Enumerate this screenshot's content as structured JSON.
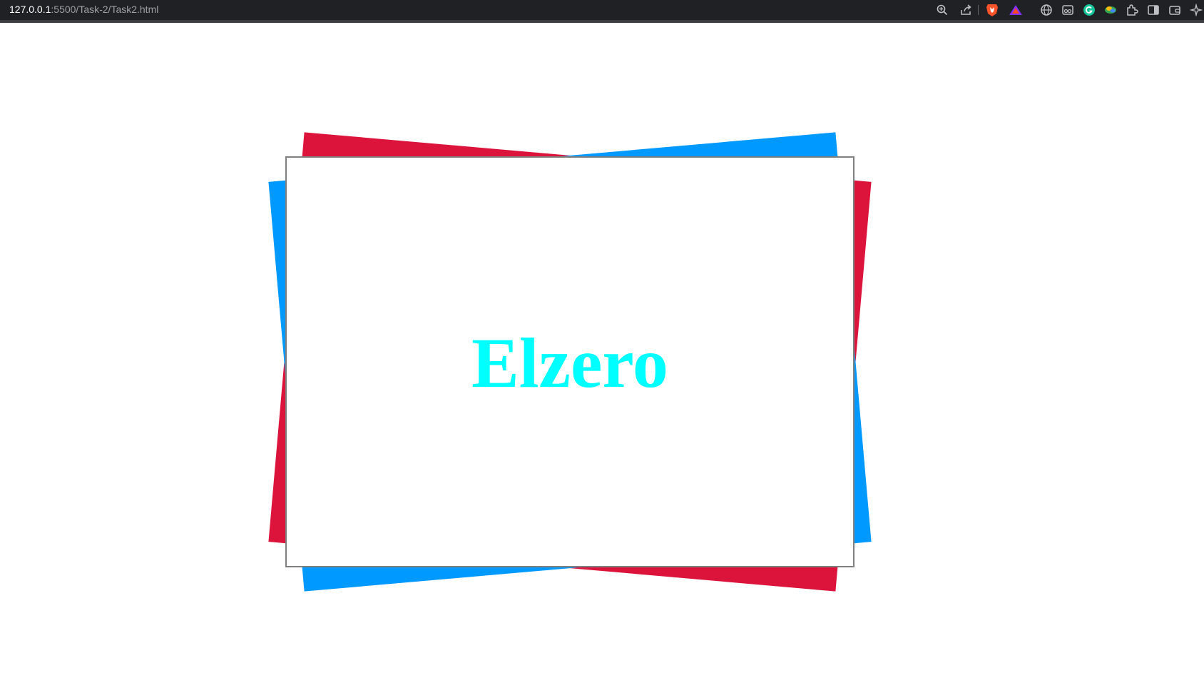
{
  "browser": {
    "url_host": "127.0.0.1",
    "url_path": ":5500/Task-2/Task2.html",
    "toolbar_icons": [
      "zoom-icon",
      "share-icon",
      "brave-shields-icon",
      "brave-rewards-icon",
      "translate-icon",
      "reader-mode-icon",
      "grammarly-icon",
      "extension-color-icon",
      "extensions-puzzle-icon",
      "sidebar-icon",
      "wallet-icon",
      "leo-ai-icon"
    ]
  },
  "page": {
    "heading": "Elzero"
  },
  "colors": {
    "accent_red": "#dc143c",
    "accent_blue": "#0099ff",
    "heading_color": "#00ffff",
    "border": "#808080"
  }
}
